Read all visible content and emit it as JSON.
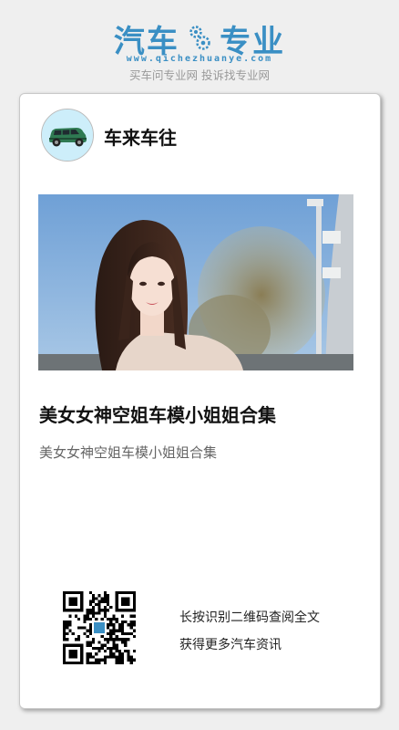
{
  "header": {
    "logo_left": "汽车",
    "logo_right": "专业",
    "domain": "www.qichezhuanye.com",
    "slogan": "买车问专业网 投诉找专业网",
    "brand_color": "#3a8fc4"
  },
  "channel": {
    "name": "车来车往",
    "avatar_icon": "car-icon"
  },
  "article": {
    "title": "美女女神空姐车模小姐姐合集",
    "summary": "美女女神空姐车模小姐姐合集"
  },
  "qr": {
    "line1": "长按识别二维码查阅全文",
    "line2": "获得更多汽车资讯"
  }
}
